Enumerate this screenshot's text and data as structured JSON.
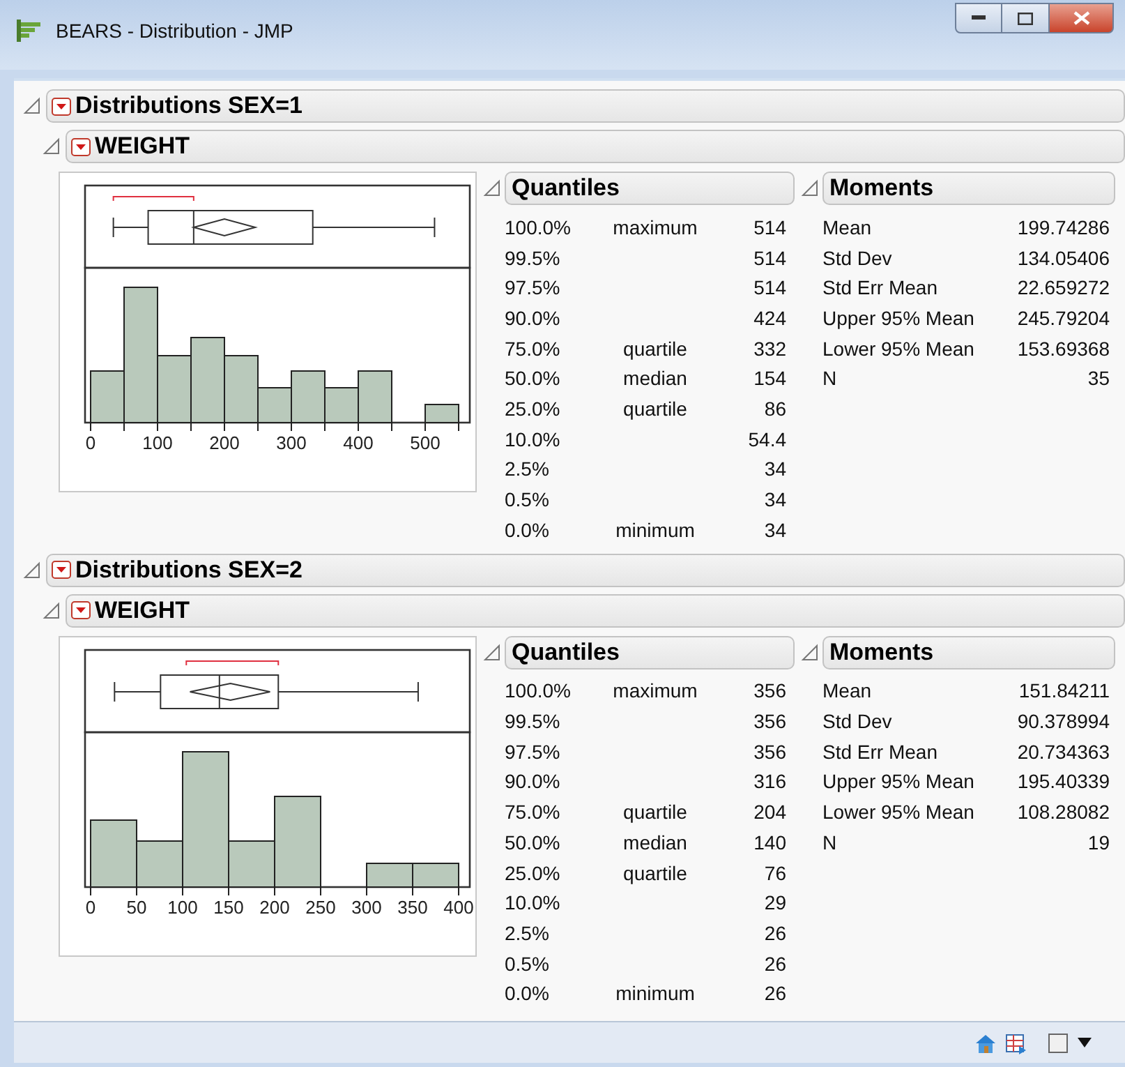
{
  "window": {
    "title": "BEARS - Distribution - JMP"
  },
  "sections": [
    {
      "title": "Distributions SEX=1",
      "expanded": true,
      "variable": {
        "title": "WEIGHT",
        "expanded": true,
        "axis_labels": [
          "0",
          "100",
          "200",
          "300",
          "400",
          "500"
        ],
        "quantiles": {
          "title": "Quantiles",
          "expanded": true,
          "rows": [
            {
              "percent": "100.0%",
              "label": "maximum",
              "value": "514"
            },
            {
              "percent": "99.5%",
              "label": "",
              "value": "514"
            },
            {
              "percent": "97.5%",
              "label": "",
              "value": "514"
            },
            {
              "percent": "90.0%",
              "label": "",
              "value": "424"
            },
            {
              "percent": "75.0%",
              "label": "quartile",
              "value": "332"
            },
            {
              "percent": "50.0%",
              "label": "median",
              "value": "154"
            },
            {
              "percent": "25.0%",
              "label": "quartile",
              "value": "86"
            },
            {
              "percent": "10.0%",
              "label": "",
              "value": "54.4"
            },
            {
              "percent": "2.5%",
              "label": "",
              "value": "34"
            },
            {
              "percent": "0.5%",
              "label": "",
              "value": "34"
            },
            {
              "percent": "0.0%",
              "label": "minimum",
              "value": "34"
            }
          ]
        },
        "moments": {
          "title": "Moments",
          "expanded": true,
          "rows": [
            {
              "label": "Mean",
              "value": "199.74286"
            },
            {
              "label": "Std Dev",
              "value": "134.05406"
            },
            {
              "label": "Std Err Mean",
              "value": "22.659272"
            },
            {
              "label": "Upper 95% Mean",
              "value": "245.79204"
            },
            {
              "label": "Lower 95% Mean",
              "value": "153.69368"
            },
            {
              "label": "N",
              "value": "35"
            }
          ]
        }
      }
    },
    {
      "title": "Distributions SEX=2",
      "expanded": true,
      "variable": {
        "title": "WEIGHT",
        "expanded": true,
        "axis_labels": [
          "0",
          "50",
          "100",
          "150",
          "200",
          "250",
          "300",
          "350",
          "400"
        ],
        "quantiles": {
          "title": "Quantiles",
          "expanded": true,
          "rows": [
            {
              "percent": "100.0%",
              "label": "maximum",
              "value": "356"
            },
            {
              "percent": "99.5%",
              "label": "",
              "value": "356"
            },
            {
              "percent": "97.5%",
              "label": "",
              "value": "356"
            },
            {
              "percent": "90.0%",
              "label": "",
              "value": "316"
            },
            {
              "percent": "75.0%",
              "label": "quartile",
              "value": "204"
            },
            {
              "percent": "50.0%",
              "label": "median",
              "value": "140"
            },
            {
              "percent": "25.0%",
              "label": "quartile",
              "value": "76"
            },
            {
              "percent": "10.0%",
              "label": "",
              "value": "29"
            },
            {
              "percent": "2.5%",
              "label": "",
              "value": "26"
            },
            {
              "percent": "0.5%",
              "label": "",
              "value": "26"
            },
            {
              "percent": "0.0%",
              "label": "minimum",
              "value": "26"
            }
          ]
        },
        "moments": {
          "title": "Moments",
          "expanded": true,
          "rows": [
            {
              "label": "Mean",
              "value": "151.84211"
            },
            {
              "label": "Std Dev",
              "value": "90.378994"
            },
            {
              "label": "Std Err Mean",
              "value": "20.734363"
            },
            {
              "label": "Upper 95% Mean",
              "value": "195.40339"
            },
            {
              "label": "Lower 95% Mean",
              "value": "108.28082"
            },
            {
              "label": "N",
              "value": "19"
            }
          ]
        }
      }
    }
  ]
}
